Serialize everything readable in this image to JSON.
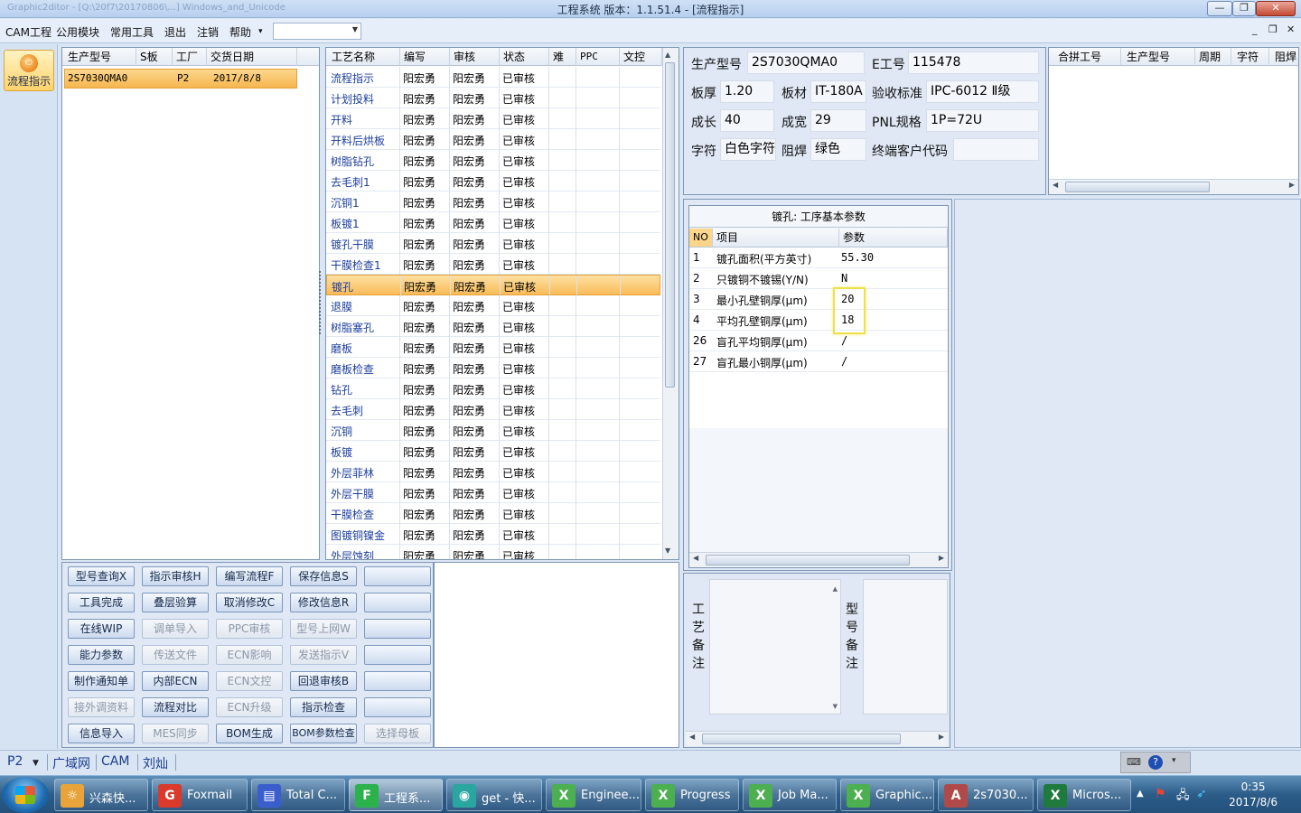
{
  "window": {
    "ghost_text": "Graphic2ditor - [Q:\\20f7\\20170806\\...] Windows_and_Unicode",
    "title": "工程系统   版本：1.1.51.4 - [流程指示]",
    "controls": [
      "—",
      "❐",
      "✕"
    ]
  },
  "menu": {
    "items": [
      "CAM工程",
      "公用模块",
      "常用工具",
      "退出",
      "注销",
      "帮助"
    ],
    "help_arrow": "▾",
    "combo_value": "",
    "mdi_controls": [
      "_",
      "❐",
      "✕"
    ]
  },
  "nav": {
    "active_label": "流程指示"
  },
  "model_list": {
    "headers": [
      "生产型号",
      "S板",
      "工厂",
      "交货日期"
    ],
    "rows": [
      {
        "model": "2S7030QMA0",
        "s_board": "",
        "factory": "P2",
        "date": "2017/8/8"
      }
    ]
  },
  "process_grid": {
    "headers": [
      "工艺名称",
      "编写",
      "审核",
      "状态",
      "难",
      "PPC",
      "文控"
    ],
    "selected_index": 10,
    "rows": [
      {
        "name": "流程指示",
        "writer": "阳宏勇",
        "reviewer": "阳宏勇",
        "status": "已审核"
      },
      {
        "name": "计划投料",
        "writer": "阳宏勇",
        "reviewer": "阳宏勇",
        "status": "已审核"
      },
      {
        "name": "开料",
        "writer": "阳宏勇",
        "reviewer": "阳宏勇",
        "status": "已审核"
      },
      {
        "name": "开料后烘板",
        "writer": "阳宏勇",
        "reviewer": "阳宏勇",
        "status": "已审核"
      },
      {
        "name": "树脂钻孔",
        "writer": "阳宏勇",
        "reviewer": "阳宏勇",
        "status": "已审核"
      },
      {
        "name": "去毛刺1",
        "writer": "阳宏勇",
        "reviewer": "阳宏勇",
        "status": "已审核"
      },
      {
        "name": "沉铜1",
        "writer": "阳宏勇",
        "reviewer": "阳宏勇",
        "status": "已审核"
      },
      {
        "name": "板镀1",
        "writer": "阳宏勇",
        "reviewer": "阳宏勇",
        "status": "已审核"
      },
      {
        "name": "镀孔干膜",
        "writer": "阳宏勇",
        "reviewer": "阳宏勇",
        "status": "已审核"
      },
      {
        "name": "干膜检查1",
        "writer": "阳宏勇",
        "reviewer": "阳宏勇",
        "status": "已审核"
      },
      {
        "name": "镀孔",
        "writer": "阳宏勇",
        "reviewer": "阳宏勇",
        "status": "已审核"
      },
      {
        "name": "退膜",
        "writer": "阳宏勇",
        "reviewer": "阳宏勇",
        "status": "已审核"
      },
      {
        "name": "树脂塞孔",
        "writer": "阳宏勇",
        "reviewer": "阳宏勇",
        "status": "已审核"
      },
      {
        "name": "磨板",
        "writer": "阳宏勇",
        "reviewer": "阳宏勇",
        "status": "已审核"
      },
      {
        "name": "磨板检查",
        "writer": "阳宏勇",
        "reviewer": "阳宏勇",
        "status": "已审核"
      },
      {
        "name": "钻孔",
        "writer": "阳宏勇",
        "reviewer": "阳宏勇",
        "status": "已审核"
      },
      {
        "name": "去毛刺",
        "writer": "阳宏勇",
        "reviewer": "阳宏勇",
        "status": "已审核"
      },
      {
        "name": "沉铜",
        "writer": "阳宏勇",
        "reviewer": "阳宏勇",
        "status": "已审核"
      },
      {
        "name": "板镀",
        "writer": "阳宏勇",
        "reviewer": "阳宏勇",
        "status": "已审核"
      },
      {
        "name": "外层菲林",
        "writer": "阳宏勇",
        "reviewer": "阳宏勇",
        "status": "已审核"
      },
      {
        "name": "外层干膜",
        "writer": "阳宏勇",
        "reviewer": "阳宏勇",
        "status": "已审核"
      },
      {
        "name": "干膜检查",
        "writer": "阳宏勇",
        "reviewer": "阳宏勇",
        "status": "已审核"
      },
      {
        "name": "图镀铜镍金",
        "writer": "阳宏勇",
        "reviewer": "阳宏勇",
        "status": "已审核"
      },
      {
        "name": "外层蚀刻",
        "writer": "阳宏勇",
        "reviewer": "阳宏勇",
        "status": "已审核"
      }
    ]
  },
  "actions": {
    "rows": [
      [
        {
          "label": "型号查询X",
          "enabled": true
        },
        {
          "label": "指示审核H",
          "enabled": true
        },
        {
          "label": "编写流程F",
          "enabled": true
        },
        {
          "label": "保存信息S",
          "enabled": true
        },
        {
          "label": "",
          "enabled": true
        }
      ],
      [
        {
          "label": "工具完成",
          "enabled": true
        },
        {
          "label": "叠层验算",
          "enabled": true
        },
        {
          "label": "取消修改C",
          "enabled": true
        },
        {
          "label": "修改信息R",
          "enabled": true
        },
        {
          "label": "",
          "enabled": true
        }
      ],
      [
        {
          "label": "在线WIP",
          "enabled": true
        },
        {
          "label": "调单导入",
          "enabled": false
        },
        {
          "label": "PPC审核",
          "enabled": false
        },
        {
          "label": "型号上网W",
          "enabled": false
        },
        {
          "label": "",
          "enabled": true
        }
      ],
      [
        {
          "label": "能力参数",
          "enabled": true
        },
        {
          "label": "传送文件",
          "enabled": false
        },
        {
          "label": "ECN影响",
          "enabled": false
        },
        {
          "label": "发送指示V",
          "enabled": false
        },
        {
          "label": "",
          "enabled": true
        }
      ],
      [
        {
          "label": "制作通知单",
          "enabled": true
        },
        {
          "label": "内部ECN",
          "enabled": true
        },
        {
          "label": "ECN文控",
          "enabled": false
        },
        {
          "label": "回退审核B",
          "enabled": true
        },
        {
          "label": "",
          "enabled": true
        }
      ],
      [
        {
          "label": "接外调资料",
          "enabled": false
        },
        {
          "label": "流程对比",
          "enabled": true
        },
        {
          "label": "ECN升级",
          "enabled": false
        },
        {
          "label": "指示检查",
          "enabled": true
        },
        {
          "label": "",
          "enabled": true
        }
      ],
      [
        {
          "label": "信息导入",
          "enabled": true
        },
        {
          "label": "MES同步",
          "enabled": false
        },
        {
          "label": "BOM生成",
          "enabled": true
        },
        {
          "label": "BOM参数检查",
          "enabled": true
        },
        {
          "label": "选择母板",
          "enabled": false
        }
      ]
    ]
  },
  "info": {
    "labels": {
      "model": "生产型号",
      "e_no": "E工号",
      "thickness": "板厚",
      "material": "板材",
      "standard": "验收标准",
      "length": "成长",
      "width": "成宽",
      "pnl": "PNL规格",
      "legend": "字符",
      "solder": "阻焊",
      "customer": "终端客户代码"
    },
    "values": {
      "model": "2S7030QMA0",
      "e_no": "115478",
      "thickness": "1.20",
      "material": "IT-180A",
      "standard": "IPC-6012 Ⅱ级",
      "length": "40",
      "width": "29",
      "pnl": "1P=72U",
      "legend": "白色字符",
      "solder": "绿色",
      "customer": ""
    }
  },
  "merge_grid": {
    "headers": [
      "合拼工号",
      "生产型号",
      "周期",
      "字符",
      "阻焊"
    ]
  },
  "params": {
    "title": "镀孔: 工序基本参数",
    "headers": [
      "NO",
      "项目",
      "参数"
    ],
    "rows": [
      {
        "no": "1",
        "item": "镀孔面积(平方英寸)",
        "value": "55.30"
      },
      {
        "no": "2",
        "item": "只镀铜不镀锡(Y/N)",
        "value": "N"
      },
      {
        "no": "3",
        "item": "最小孔壁铜厚(μm)",
        "value": "20"
      },
      {
        "no": "4",
        "item": "平均孔壁铜厚(μm)",
        "value": "18"
      },
      {
        "no": "26",
        "item": "盲孔平均铜厚(μm)",
        "value": "/"
      },
      {
        "no": "27",
        "item": "盲孔最小铜厚(μm)",
        "value": "/"
      }
    ]
  },
  "remarks": {
    "process_label": [
      "工",
      "艺",
      "备",
      "注"
    ],
    "model_label": [
      "型",
      "号",
      "备",
      "注"
    ],
    "process_text": "",
    "model_text": ""
  },
  "status": {
    "factory": "P2",
    "items": [
      "广域网",
      "CAM",
      "刘灿"
    ]
  },
  "taskbar": {
    "buttons": [
      {
        "label": "兴森快...",
        "icon": "sun-icon",
        "color": "#e8a43a"
      },
      {
        "label": "Foxmail",
        "icon": "foxmail-icon",
        "color": "#d93a2b"
      },
      {
        "label": "Total C...",
        "icon": "floppy-icon",
        "color": "#3a5fcd"
      },
      {
        "label": "工程系...",
        "icon": "engineering-icon",
        "color": "#2bb24c"
      },
      {
        "label": "get - 快...",
        "icon": "eye-icon",
        "color": "#2aa6a0"
      },
      {
        "label": "Enginee...",
        "icon": "x-doc-icon",
        "color": "#4caf50"
      },
      {
        "label": "Progress",
        "icon": "x-doc-icon",
        "color": "#4caf50"
      },
      {
        "label": "Job Ma...",
        "icon": "x-doc-icon",
        "color": "#4caf50"
      },
      {
        "label": "Graphic...",
        "icon": "x-doc-icon",
        "color": "#4caf50"
      },
      {
        "label": "2s7030...",
        "icon": "access-icon",
        "color": "#b04a4a"
      },
      {
        "label": "Micros...",
        "icon": "excel-icon",
        "color": "#1f7a3d"
      }
    ],
    "clock_time": "0:35",
    "clock_date": "2017/8/6"
  }
}
